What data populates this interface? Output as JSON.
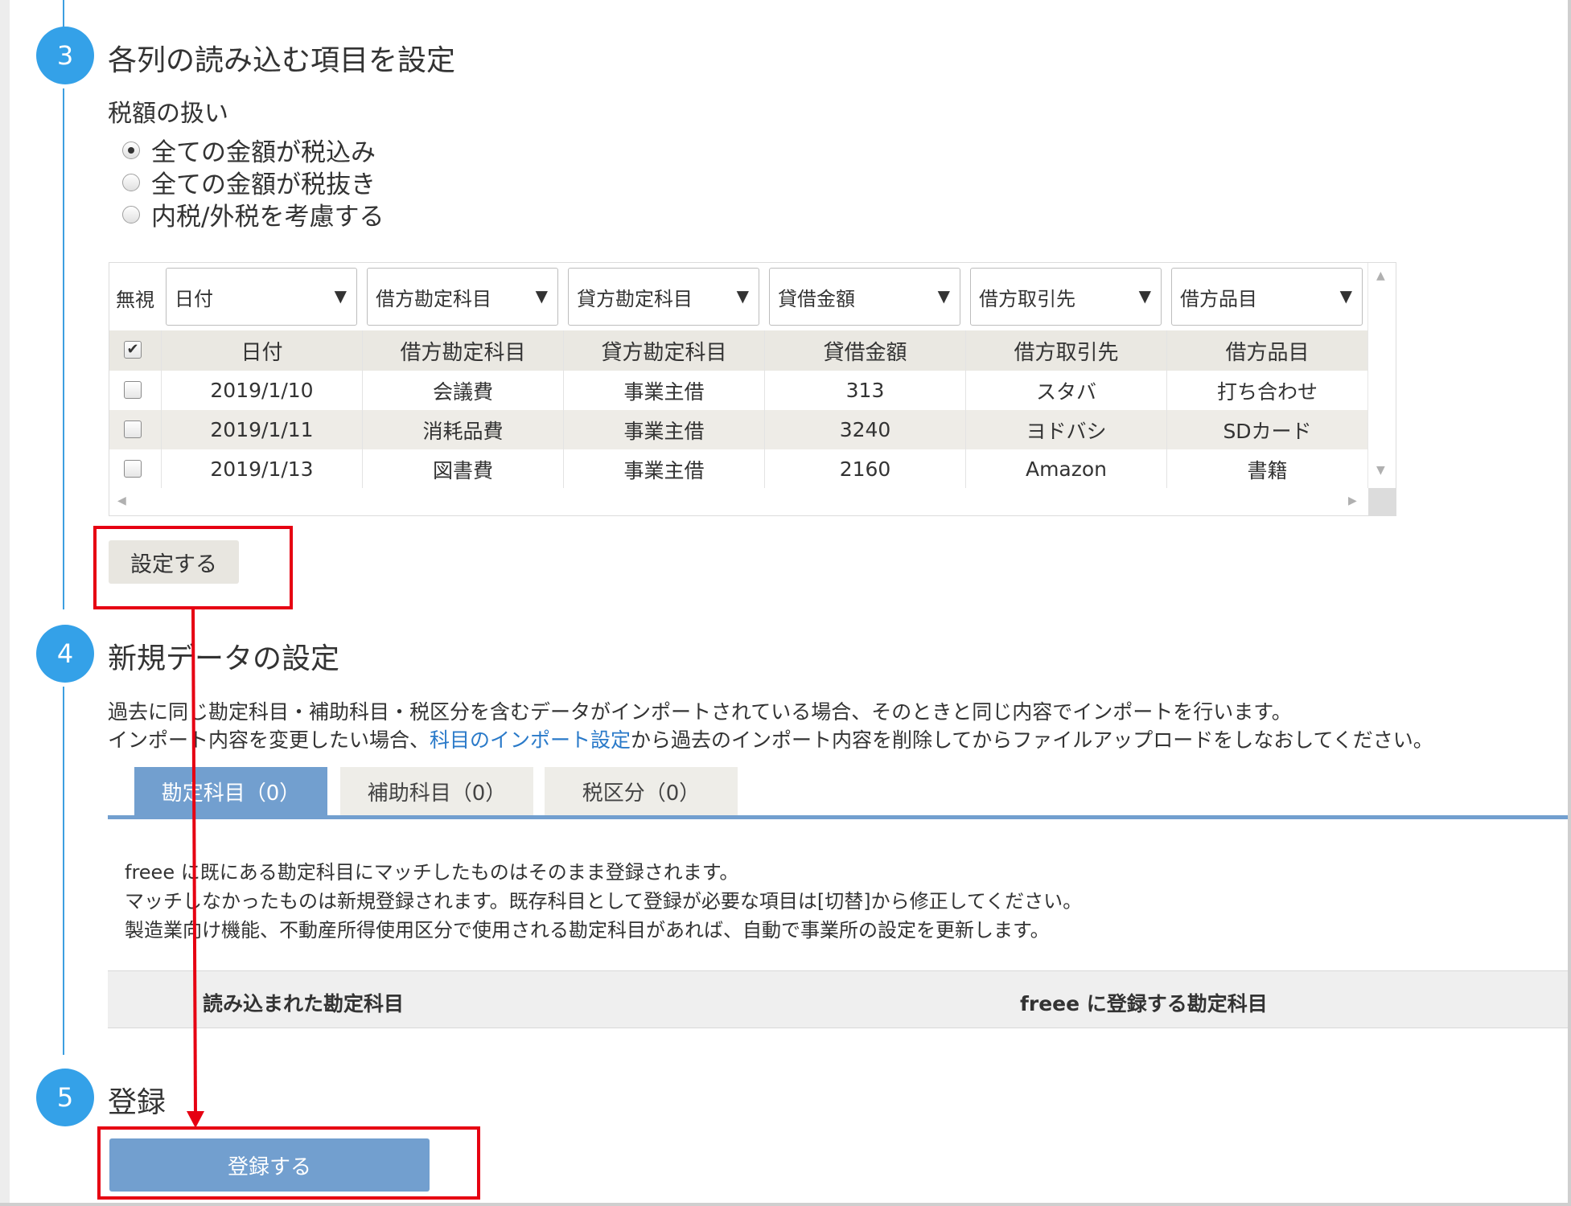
{
  "steps": [
    {
      "number": "3",
      "title": "各列の読み込む項目を設定"
    },
    {
      "number": "4",
      "title": "新規データの設定"
    },
    {
      "number": "5",
      "title": "登録"
    }
  ],
  "tax": {
    "label": "税額の扱い",
    "options": [
      {
        "label": "全ての金額が税込み",
        "checked": true
      },
      {
        "label": "全ての金額が税抜き",
        "checked": false
      },
      {
        "label": "内税/外税を考慮する",
        "checked": false
      }
    ]
  },
  "grid": {
    "ignore_label": "無視",
    "column_selects": [
      "日付",
      "借方勘定科目",
      "貸方勘定科目",
      "貸借金額",
      "借方取引先",
      "借方品目"
    ],
    "headers": [
      "日付",
      "借方勘定科目",
      "貸方勘定科目",
      "貸借金額",
      "借方取引先",
      "借方品目"
    ],
    "header_checked": true,
    "rows": [
      {
        "checked": false,
        "cells": [
          "2019/1/10",
          "会議費",
          "事業主借",
          "313",
          "スタバ",
          "打ち合わせ"
        ]
      },
      {
        "checked": false,
        "cells": [
          "2019/1/11",
          "消耗品費",
          "事業主借",
          "3240",
          "ヨドバシ",
          "SDカード"
        ]
      },
      {
        "checked": false,
        "cells": [
          "2019/1/13",
          "図書費",
          "事業主借",
          "2160",
          "Amazon",
          "書籍"
        ]
      }
    ]
  },
  "set_button_label": "設定する",
  "new_data": {
    "line1": "過去に同じ勘定科目・補助科目・税区分を含むデータがインポートされている場合、そのときと同じ内容でインポートを行います。",
    "line2_before": "インポート内容を変更したい場合、",
    "line2_link": "科目のインポート設定",
    "line2_after": "から過去のインポート内容を削除してからファイルアップロードをしなおしてください。",
    "tabs": [
      {
        "label": "勘定科目（0）",
        "active": true
      },
      {
        "label": "補助科目（0）",
        "active": false
      },
      {
        "label": "税区分（0）",
        "active": false
      }
    ],
    "info": [
      "freee に既にある勘定科目にマッチしたものはそのまま登録されます。",
      "マッチしなかったものは新規登録されます。既存科目として登録が必要な項目は[切替]から修正してください。",
      "製造業向け機能、不動産所得使用区分で使用される勘定科目があれば、自動で事業所の設定を更新します。"
    ],
    "mapping_headers": [
      "読み込まれた勘定科目",
      "freee に登録する勘定科目"
    ]
  },
  "register_button_label": "登録する",
  "colors": {
    "step_circle": "#34a1e8",
    "primary_button": "#729fcf",
    "annotation_red": "#e60012",
    "link": "#2a7ac9"
  }
}
